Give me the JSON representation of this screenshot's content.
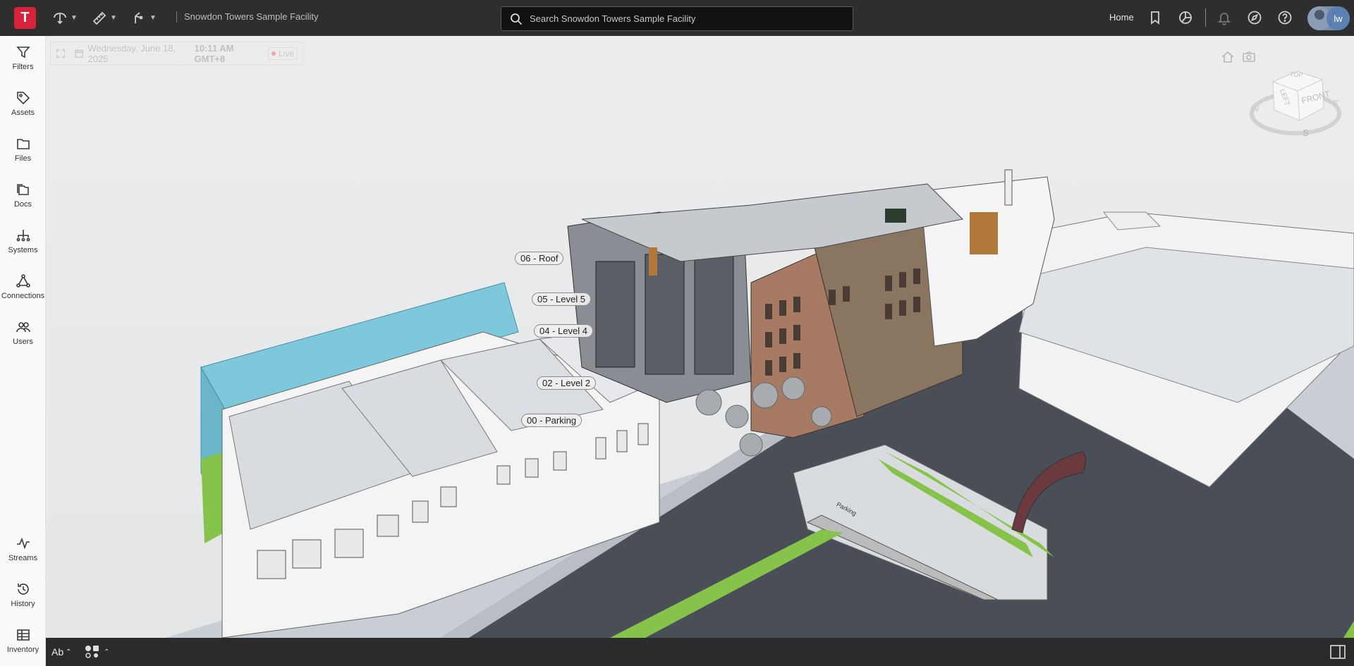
{
  "app": {
    "logo_letter": "T",
    "project_name": "Snowdon Towers Sample Facility"
  },
  "search": {
    "placeholder": "Search Snowdon Towers Sample Facility"
  },
  "header": {
    "home_label": "Home"
  },
  "user": {
    "initials": "lw"
  },
  "sidebar": {
    "top_items": [
      {
        "label": "Filters",
        "icon": "filter-icon"
      },
      {
        "label": "Assets",
        "icon": "tag-icon"
      },
      {
        "label": "Files",
        "icon": "folder-icon"
      },
      {
        "label": "Docs",
        "icon": "docs-icon"
      },
      {
        "label": "Systems",
        "icon": "hierarchy-icon"
      },
      {
        "label": "Connections",
        "icon": "connections-icon"
      },
      {
        "label": "Users",
        "icon": "users-icon"
      }
    ],
    "bottom_items": [
      {
        "label": "Streams",
        "icon": "pulse-icon"
      },
      {
        "label": "History",
        "icon": "history-icon"
      },
      {
        "label": "Inventory",
        "icon": "table-icon"
      }
    ]
  },
  "timebar": {
    "date": "Wednesday, June 18, 2025",
    "time": "10:11 AM GMT+8",
    "live_label": "Live"
  },
  "viewcube": {
    "top": "TOP",
    "left": "LEFT",
    "front": "FRONT",
    "compass_w": "W",
    "compass_s": "S",
    "compass_e": "E"
  },
  "levels": [
    {
      "label": "06 - Roof"
    },
    {
      "label": "05 - Level 5"
    },
    {
      "label": "04 - Level 4"
    },
    {
      "label": "02 - Level 2"
    },
    {
      "label": "00 - Parking"
    }
  ],
  "scene": {
    "sign_text": "Parking"
  },
  "bottombar": {
    "text_style_label": "Ab"
  },
  "colors": {
    "brand": "#d6223b",
    "highlight_level": "#7ec8dc",
    "grass": "#86c34a",
    "road": "#4a4f57"
  }
}
